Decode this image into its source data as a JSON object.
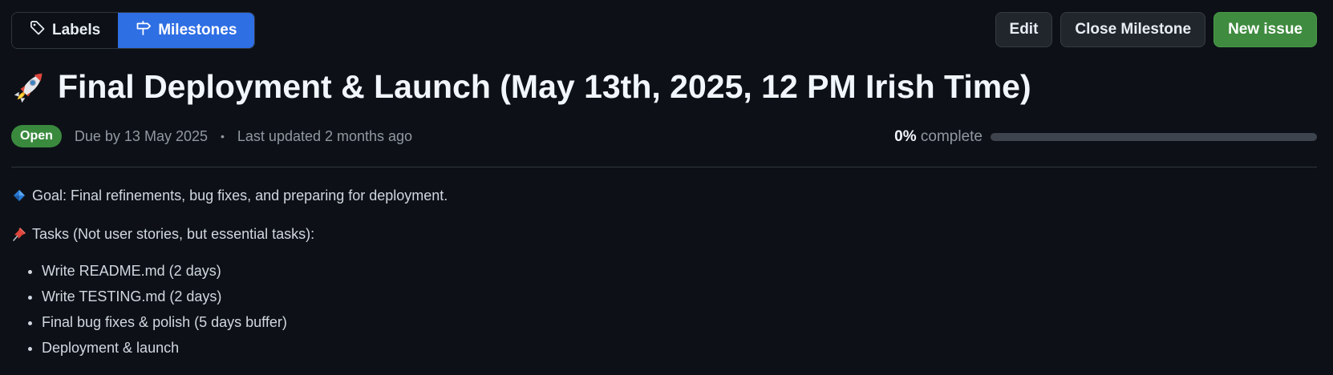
{
  "tabs": [
    {
      "label": "Labels",
      "icon": "tag-icon"
    },
    {
      "label": "Milestones",
      "icon": "milestone-icon",
      "active": true
    }
  ],
  "actions": {
    "edit_label": "Edit",
    "close_label": "Close Milestone",
    "new_issue_label": "New issue"
  },
  "milestone": {
    "title_icon": "rocket-emoji",
    "title": "Final Deployment & Launch (May 13th, 2025, 12 PM Irish Time)",
    "status": "Open",
    "due": "Due by 13 May 2025",
    "separator": "•",
    "updated": "Last updated 2 months ago",
    "percent_label": "0%",
    "complete_label": "complete",
    "progress_fraction": 0
  },
  "description": {
    "goal_icon": "blue-diamond-emoji",
    "goal": "Goal: Final refinements, bug fixes, and preparing for deployment.",
    "tasks_icon": "pushpin-emoji",
    "tasks_heading": "Tasks (Not user stories, but essential tasks):",
    "tasks": [
      "Write README.md (2 days)",
      "Write TESTING.md (2 days)",
      "Final bug fixes & polish (5 days buffer)",
      "Deployment & launch"
    ]
  },
  "colors": {
    "background": "#0d1117",
    "active_tab": "#2f6fe4",
    "primary_button": "#3f8b3f",
    "open_badge": "#3a8a3e"
  }
}
